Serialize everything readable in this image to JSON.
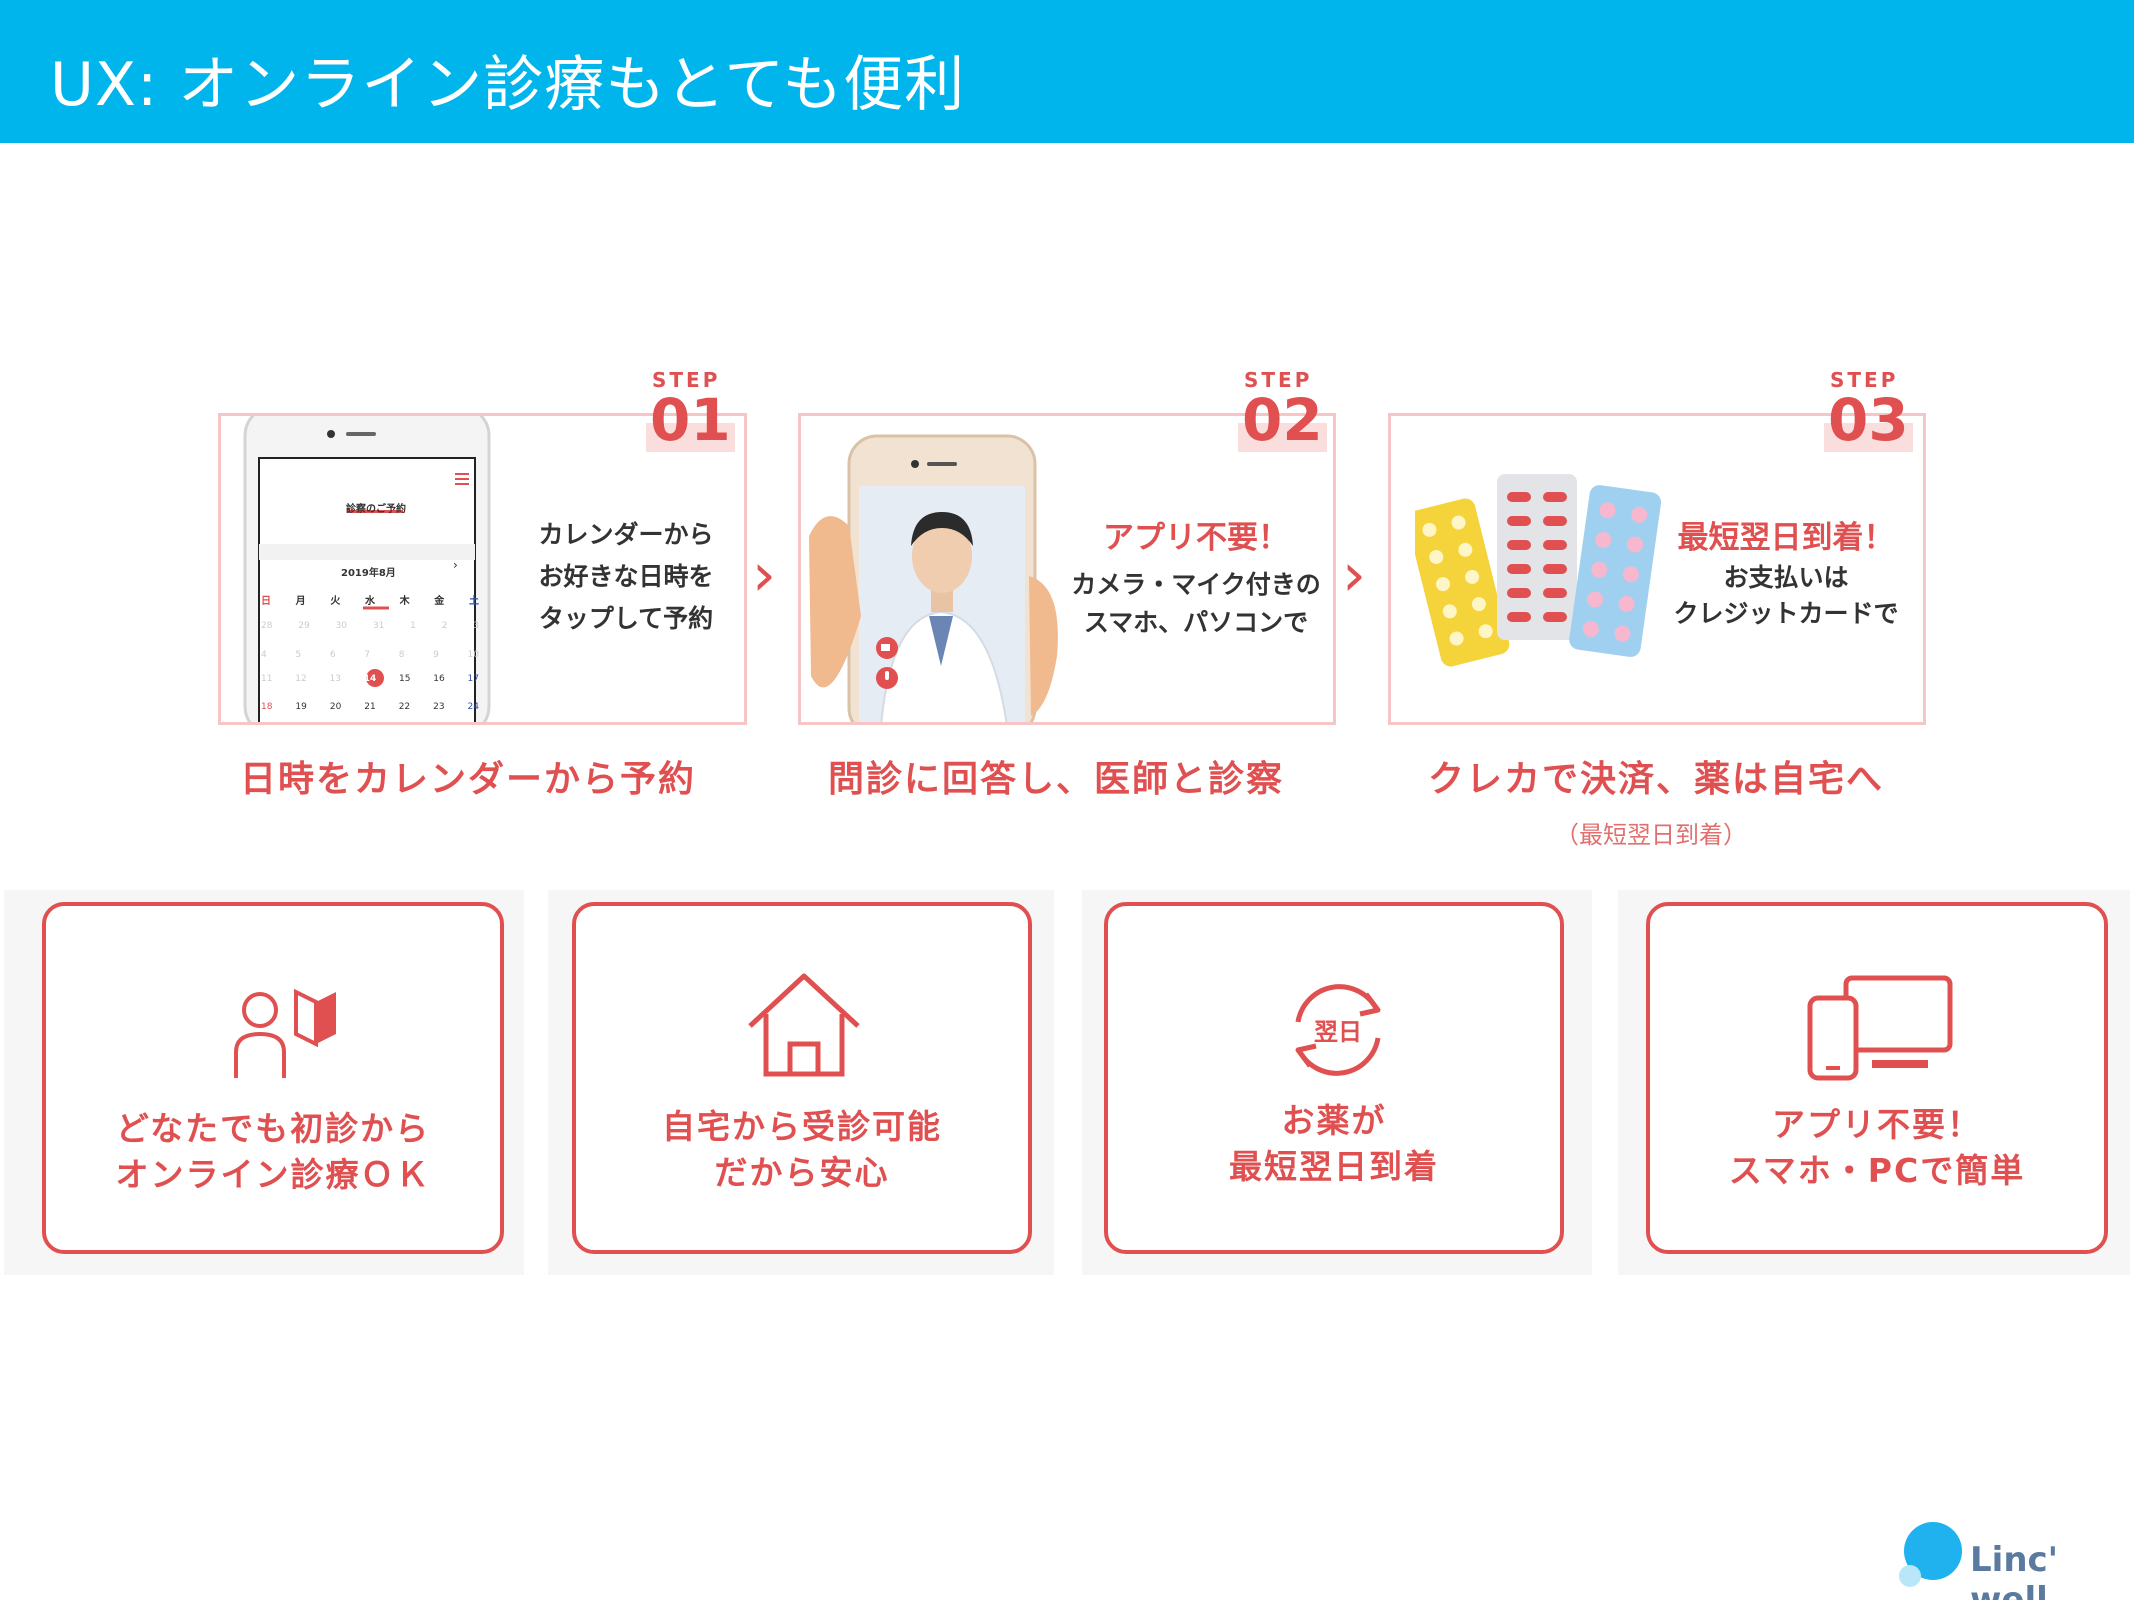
{
  "header": {
    "title": "UX: オンライン診療もとても便利"
  },
  "steps": [
    {
      "label": "STEP",
      "num": "01",
      "lines": [
        "カレンダーから",
        "お好きな日時を",
        "タップして予約"
      ],
      "caption": "日時をカレンダーから予約",
      "phone": {
        "title": "診察のご予約",
        "month": "2019年8月",
        "weekdays": [
          "日",
          "月",
          "火",
          "水",
          "木",
          "金",
          "土"
        ],
        "row1": [
          "28",
          "29",
          "30",
          "31",
          "1",
          "2",
          "3"
        ],
        "row2": [
          "4",
          "5",
          "6",
          "7",
          "8",
          "9",
          "10"
        ],
        "row3": [
          "11",
          "12",
          "13",
          "14",
          "15",
          "16",
          "17"
        ],
        "row4": [
          "18",
          "19",
          "20",
          "21",
          "22",
          "23",
          "24"
        ]
      }
    },
    {
      "label": "STEP",
      "num": "02",
      "head": "アプリ不要！",
      "lines": [
        "カメラ・マイク付きの",
        "スマホ、パソコンで"
      ],
      "caption": "問診に回答し、医師と診察"
    },
    {
      "label": "STEP",
      "num": "03",
      "head": "最短翌日到着！",
      "lines": [
        "お支払いは",
        "クレジットカードで"
      ],
      "caption": "クレカで決済、薬は自宅へ",
      "sub": "（最短翌日到着）"
    }
  ],
  "features": [
    {
      "icon": "person-book-icon",
      "lines": [
        "どなたでも初診から",
        "オンライン診療ＯＫ"
      ]
    },
    {
      "icon": "house-icon",
      "lines": [
        "自宅から受診可能",
        "だから安心"
      ]
    },
    {
      "icon": "next-day-cycle-icon",
      "badge": "翌日",
      "lines": [
        "お薬が",
        "最短翌日到着"
      ]
    },
    {
      "icon": "devices-icon",
      "lines": [
        "アプリ不要！",
        "スマホ・PCで簡単"
      ]
    }
  ],
  "logo": {
    "text": "Linc' well"
  },
  "colors": {
    "header": "#00b5ec",
    "accent": "#e05050",
    "logo": "#1fb2ee"
  }
}
